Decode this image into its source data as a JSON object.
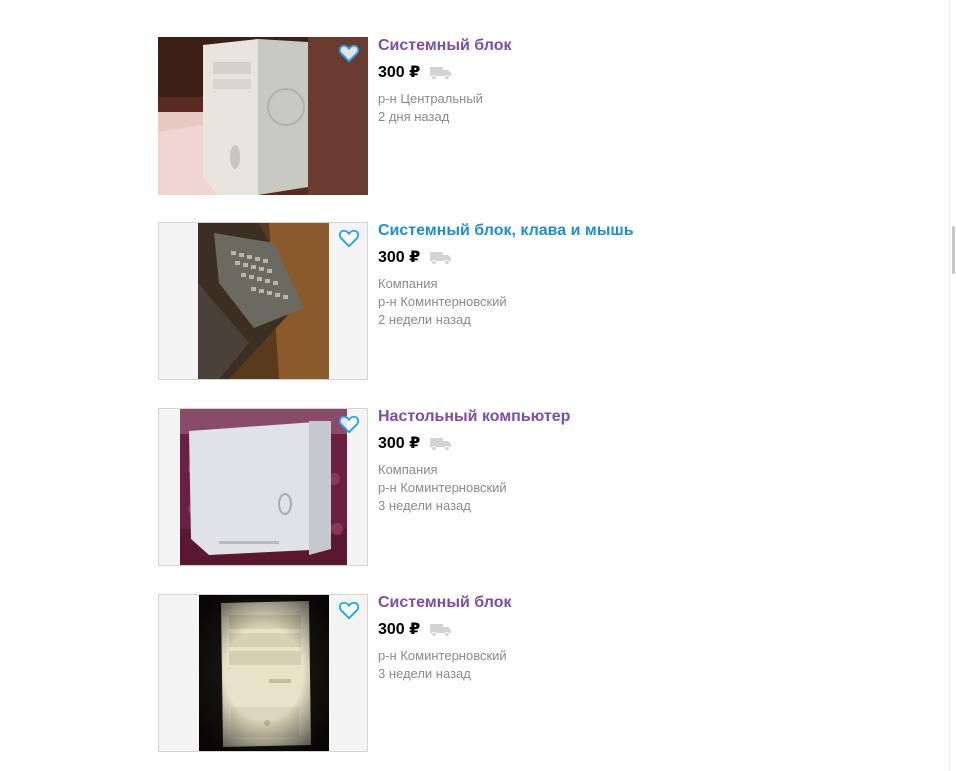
{
  "currency_symbol": "₽",
  "colors": {
    "title_visited": "#7b4ea8",
    "title_link": "#1c8fd3",
    "favorite_outline": "#1ca4f0",
    "meta_text": "#8a8a8a"
  },
  "listings": [
    {
      "title": "Системный блок",
      "price": "300 ₽",
      "company": "",
      "district": "р-н Центральный",
      "date": "2 дня назад",
      "icon": "heart-outline-icon"
    },
    {
      "title": "Системный блок, клава и мышь",
      "price": "300 ₽",
      "company": "Компания",
      "district": "р-н Коминтерновский",
      "date": "2 недели назад",
      "icon": "heart-outline-icon"
    },
    {
      "title": "Настольный компьютер",
      "price": "300 ₽",
      "company": "Компания",
      "district": "р-н Коминтерновский",
      "date": "3 недели назад",
      "icon": "heart-outline-icon"
    },
    {
      "title": "Системный блок",
      "price": "300 ₽",
      "company": "",
      "district": "р-н Коминтерновский",
      "date": "3 недели назад",
      "icon": "heart-outline-icon"
    }
  ]
}
